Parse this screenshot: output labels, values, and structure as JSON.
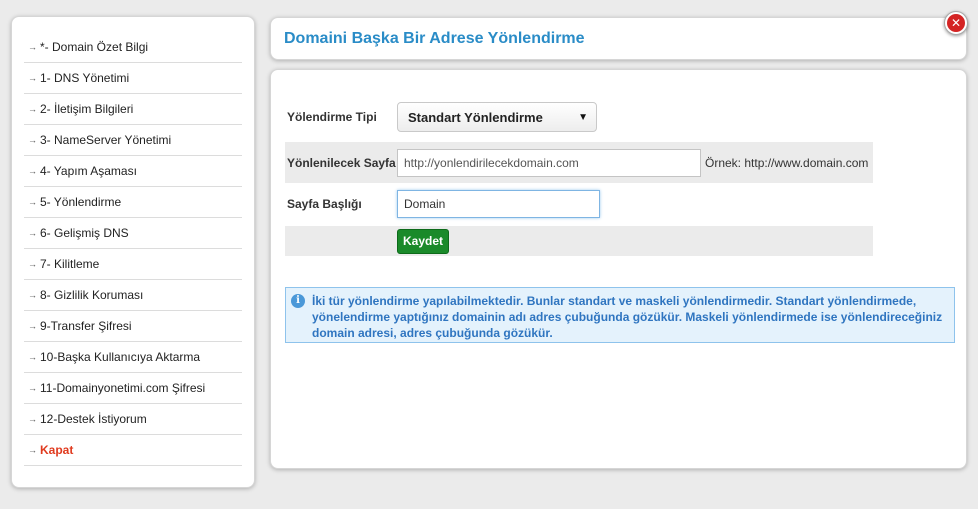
{
  "sidebar": {
    "items": [
      {
        "label": "*- Domain Özet Bilgi"
      },
      {
        "label": "1- DNS Yönetimi"
      },
      {
        "label": "2- İletişim Bilgileri"
      },
      {
        "label": "3- NameServer Yönetimi"
      },
      {
        "label": "4- Yapım Aşaması"
      },
      {
        "label": "5- Yönlendirme"
      },
      {
        "label": "6- Gelişmiş DNS"
      },
      {
        "label": "7- Kilitleme"
      },
      {
        "label": "8- Gizlilik Koruması"
      },
      {
        "label": "9-Transfer Şifresi"
      },
      {
        "label": "10-Başka Kullanıcıya Aktarma"
      },
      {
        "label": "11-Domainyonetimi.com Şifresi"
      },
      {
        "label": "12-Destek İstiyorum"
      },
      {
        "label": "Kapat"
      }
    ],
    "arrow_glyph": "→",
    "close_color": "#e03a1e"
  },
  "header": {
    "title": "Domaini Başka Bir Adrese Yönlendirme",
    "title_color": "#2a8cc7",
    "close_icon_glyph": "✕"
  },
  "form": {
    "type_label": "Yölendirme Tipi",
    "type_value": "Standart Yönlendirme",
    "caret_glyph": "▼",
    "url_label": "Yönlenilecek Sayfa",
    "url_value": "http://yonlendirilecekdomain.com",
    "url_example": "Örnek:  http://www.domain.com",
    "title_label": "Sayfa Başlığı",
    "title_value": "Domain",
    "submit_label": "Kaydet",
    "submit_color": "#1a8a2a"
  },
  "info": {
    "icon_glyph": "i",
    "text": "İki tür yönlendirme yapılabilmektedir. Bunlar standart ve maskeli yönlendirmedir. Standart yönlendirmede, yönelendirme yaptığınız domainin adı adres çubuğunda gözükür. Maskeli yönlendirmede ise yönlendireceğiniz domain adresi, adres çubuğunda gözükür."
  }
}
